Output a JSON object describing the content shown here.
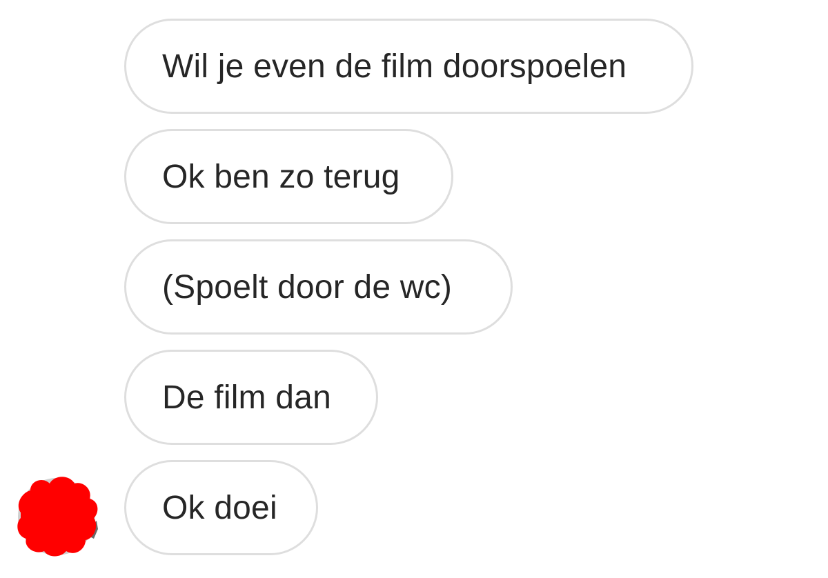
{
  "conversation": {
    "messages": [
      {
        "text": "Wil je even de film doorspoelen"
      },
      {
        "text": "Ok ben zo terug"
      },
      {
        "text": "(Spoelt door de wc)"
      },
      {
        "text": "De film dan"
      },
      {
        "text": "Ok doei"
      }
    ]
  },
  "colors": {
    "bubble_border": "#dedede",
    "text": "#262626",
    "background": "#ffffff",
    "avatar_scribble": "#ff0000"
  },
  "icons": {
    "avatar": "sender-avatar-redacted"
  }
}
